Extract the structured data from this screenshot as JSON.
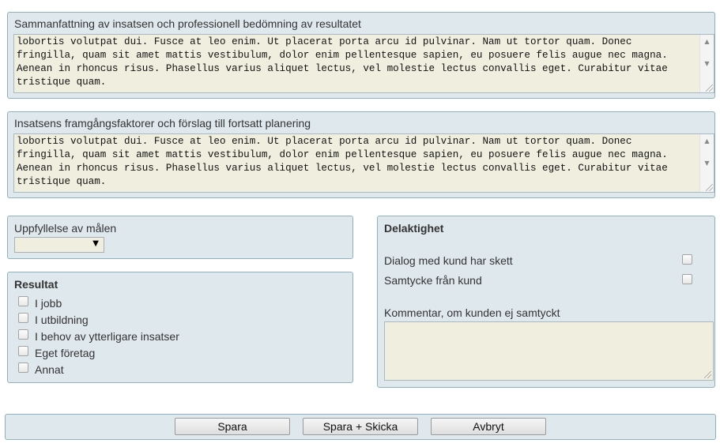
{
  "summary": {
    "label": "Sammanfattning av insatsen och professionell bedömning av resultatet",
    "lines": [
      "lobortis volutpat dui. Fusce at leo enim. Ut placerat porta arcu id pulvinar. Nam ut tortor quam. Donec",
      "fringilla, quam sit amet mattis vestibulum, dolor enim pellentesque sapien, eu posuere felis augue nec magna.",
      "Aenean in rhoncus risus. Phasellus varius aliquet lectus, vel molestie lectus convallis eget. Curabitur vitae",
      "tristique quam."
    ]
  },
  "success": {
    "label": "Insatsens framgångsfaktorer och förslag till fortsatt planering",
    "lines": [
      "lobortis volutpat dui. Fusce at leo enim. Ut placerat porta arcu id pulvinar. Nam ut tortor quam. Donec",
      "fringilla, quam sit amet mattis vestibulum, dolor enim pellentesque sapien, eu posuere felis augue nec magna.",
      "Aenean in rhoncus risus. Phasellus varius aliquet lectus, vel molestie lectus convallis eget. Curabitur vitae",
      "tristique quam."
    ]
  },
  "goals": {
    "label": "Uppfyllelse av målen",
    "selected": ""
  },
  "result": {
    "title": "Resultat",
    "options": [
      "I jobb",
      "I utbildning",
      "I behov av ytterligare insatser",
      "Eget företag",
      "Annat"
    ]
  },
  "participation": {
    "title": "Delaktighet",
    "options": [
      "Dialog med kund har skett",
      "Samtycke från kund"
    ],
    "comment_label": "Kommentar, om kunden ej samtyckt",
    "comment_value": ""
  },
  "buttons": {
    "save": "Spara",
    "save_send": "Spara + Skicka",
    "cancel": "Avbryt"
  },
  "colors": {
    "panel_bg": "#dfe8ec",
    "panel_border": "#8fb0bf",
    "field_bg": "#f0efdf"
  }
}
